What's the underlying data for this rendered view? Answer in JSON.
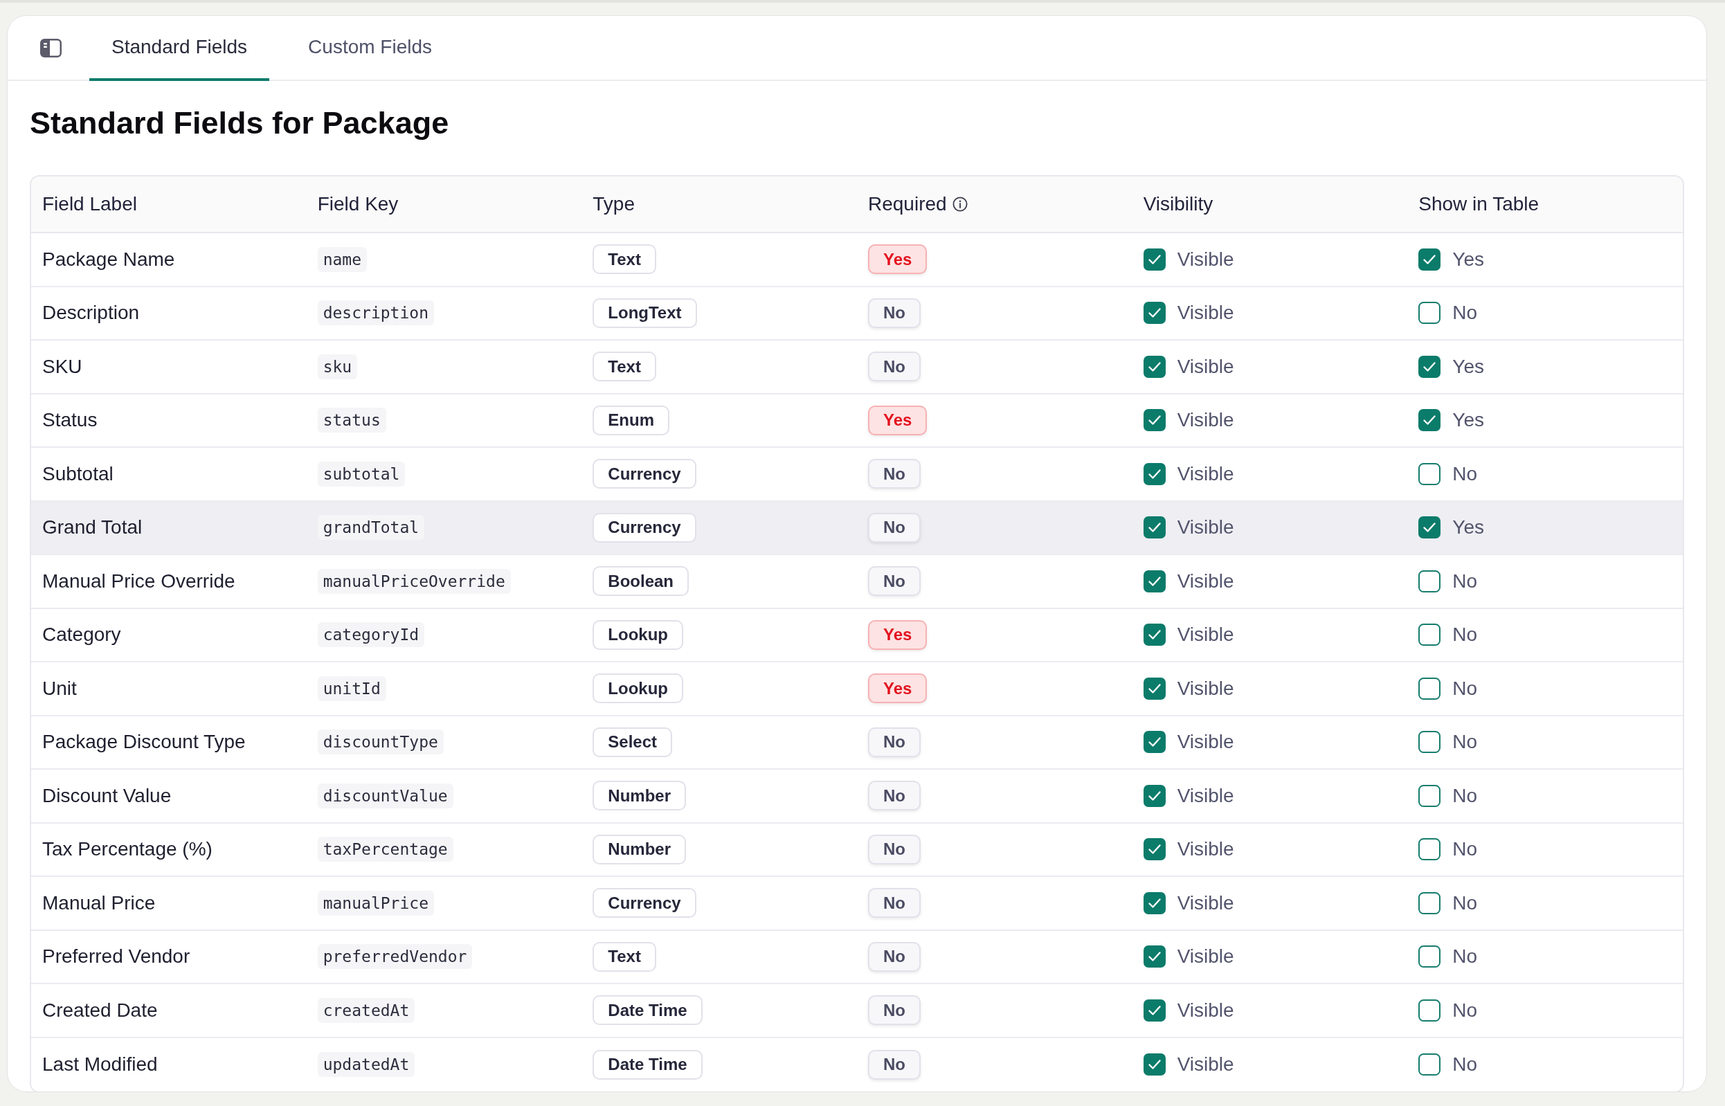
{
  "tabs": [
    {
      "label": "Standard Fields",
      "selected": true
    },
    {
      "label": "Custom Fields",
      "selected": false
    }
  ],
  "title": "Standard Fields for Package",
  "table": {
    "columns": [
      {
        "label": "Field Label",
        "info": false
      },
      {
        "label": "Field Key",
        "info": false
      },
      {
        "label": "Type",
        "info": false
      },
      {
        "label": "Required",
        "info": true
      },
      {
        "label": "Visibility",
        "info": false
      },
      {
        "label": "Show in Table",
        "info": false
      }
    ],
    "rows": [
      {
        "label": "Package Name",
        "key": "name",
        "type": "Text",
        "required": {
          "text": "Yes",
          "on": true
        },
        "visibility": {
          "text": "Visible",
          "checked": true
        },
        "show_in_table": {
          "text": "Yes",
          "checked": true
        },
        "hovered": false
      },
      {
        "label": "Description",
        "key": "description",
        "type": "LongText",
        "required": {
          "text": "No",
          "on": false
        },
        "visibility": {
          "text": "Visible",
          "checked": true
        },
        "show_in_table": {
          "text": "No",
          "checked": false
        },
        "hovered": false
      },
      {
        "label": "SKU",
        "key": "sku",
        "type": "Text",
        "required": {
          "text": "No",
          "on": false
        },
        "visibility": {
          "text": "Visible",
          "checked": true
        },
        "show_in_table": {
          "text": "Yes",
          "checked": true
        },
        "hovered": false
      },
      {
        "label": "Status",
        "key": "status",
        "type": "Enum",
        "required": {
          "text": "Yes",
          "on": true
        },
        "visibility": {
          "text": "Visible",
          "checked": true
        },
        "show_in_table": {
          "text": "Yes",
          "checked": true
        },
        "hovered": false
      },
      {
        "label": "Subtotal",
        "key": "subtotal",
        "type": "Currency",
        "required": {
          "text": "No",
          "on": false
        },
        "visibility": {
          "text": "Visible",
          "checked": true
        },
        "show_in_table": {
          "text": "No",
          "checked": false
        },
        "hovered": false
      },
      {
        "label": "Grand Total",
        "key": "grandTotal",
        "type": "Currency",
        "required": {
          "text": "No",
          "on": false
        },
        "visibility": {
          "text": "Visible",
          "checked": true
        },
        "show_in_table": {
          "text": "Yes",
          "checked": true
        },
        "hovered": true
      },
      {
        "label": "Manual Price Override",
        "key": "manualPriceOverride",
        "type": "Boolean",
        "required": {
          "text": "No",
          "on": false
        },
        "visibility": {
          "text": "Visible",
          "checked": true
        },
        "show_in_table": {
          "text": "No",
          "checked": false
        },
        "hovered": false
      },
      {
        "label": "Category",
        "key": "categoryId",
        "type": "Lookup",
        "required": {
          "text": "Yes",
          "on": true
        },
        "visibility": {
          "text": "Visible",
          "checked": true
        },
        "show_in_table": {
          "text": "No",
          "checked": false
        },
        "hovered": false
      },
      {
        "label": "Unit",
        "key": "unitId",
        "type": "Lookup",
        "required": {
          "text": "Yes",
          "on": true
        },
        "visibility": {
          "text": "Visible",
          "checked": true
        },
        "show_in_table": {
          "text": "No",
          "checked": false
        },
        "hovered": false
      },
      {
        "label": "Package Discount Type",
        "key": "discountType",
        "type": "Select",
        "required": {
          "text": "No",
          "on": false
        },
        "visibility": {
          "text": "Visible",
          "checked": true
        },
        "show_in_table": {
          "text": "No",
          "checked": false
        },
        "hovered": false
      },
      {
        "label": "Discount Value",
        "key": "discountValue",
        "type": "Number",
        "required": {
          "text": "No",
          "on": false
        },
        "visibility": {
          "text": "Visible",
          "checked": true
        },
        "show_in_table": {
          "text": "No",
          "checked": false
        },
        "hovered": false
      },
      {
        "label": "Tax Percentage (%)",
        "key": "taxPercentage",
        "type": "Number",
        "required": {
          "text": "No",
          "on": false
        },
        "visibility": {
          "text": "Visible",
          "checked": true
        },
        "show_in_table": {
          "text": "No",
          "checked": false
        },
        "hovered": false
      },
      {
        "label": "Manual Price",
        "key": "manualPrice",
        "type": "Currency",
        "required": {
          "text": "No",
          "on": false
        },
        "visibility": {
          "text": "Visible",
          "checked": true
        },
        "show_in_table": {
          "text": "No",
          "checked": false
        },
        "hovered": false
      },
      {
        "label": "Preferred Vendor",
        "key": "preferredVendor",
        "type": "Text",
        "required": {
          "text": "No",
          "on": false
        },
        "visibility": {
          "text": "Visible",
          "checked": true
        },
        "show_in_table": {
          "text": "No",
          "checked": false
        },
        "hovered": false
      },
      {
        "label": "Created Date",
        "key": "createdAt",
        "type": "Date Time",
        "required": {
          "text": "No",
          "on": false
        },
        "visibility": {
          "text": "Visible",
          "checked": true
        },
        "show_in_table": {
          "text": "No",
          "checked": false
        },
        "hovered": false
      },
      {
        "label": "Last Modified",
        "key": "updatedAt",
        "type": "Date Time",
        "required": {
          "text": "No",
          "on": false
        },
        "visibility": {
          "text": "Visible",
          "checked": true
        },
        "show_in_table": {
          "text": "No",
          "checked": false
        },
        "hovered": false
      }
    ]
  }
}
